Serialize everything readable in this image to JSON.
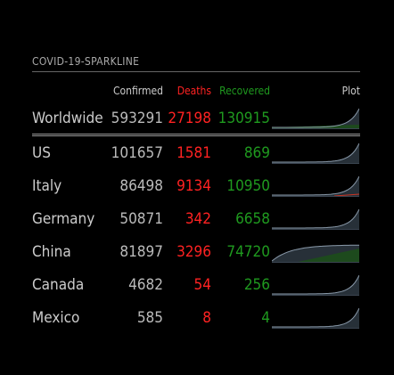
{
  "title": "COVID-19-SPARKLINE",
  "headers": {
    "name": "",
    "confirmed": "Confirmed",
    "deaths": "Deaths",
    "recovered": "Recovered",
    "plot": "Plot"
  },
  "colors": {
    "deaths": "#ff2222",
    "recovered": "#1f9a1f",
    "plot_line": "#8a9aaa",
    "plot_fill": "#273038",
    "plot_recovered_fill": "#1d4a1d",
    "plot_death_line": "#cc3322"
  },
  "rows": [
    {
      "name": "Worldwide",
      "confirmed": "593291",
      "deaths": "27198",
      "recovered": "130915"
    },
    {
      "name": "US",
      "confirmed": "101657",
      "deaths": "1581",
      "recovered": "869"
    },
    {
      "name": "Italy",
      "confirmed": "86498",
      "deaths": "9134",
      "recovered": "10950"
    },
    {
      "name": "Germany",
      "confirmed": "50871",
      "deaths": "342",
      "recovered": "6658"
    },
    {
      "name": "China",
      "confirmed": "81897",
      "deaths": "3296",
      "recovered": "74720"
    },
    {
      "name": "Canada",
      "confirmed": "4682",
      "deaths": "54",
      "recovered": "256"
    },
    {
      "name": "Mexico",
      "confirmed": "585",
      "deaths": "8",
      "recovered": "4"
    }
  ]
}
